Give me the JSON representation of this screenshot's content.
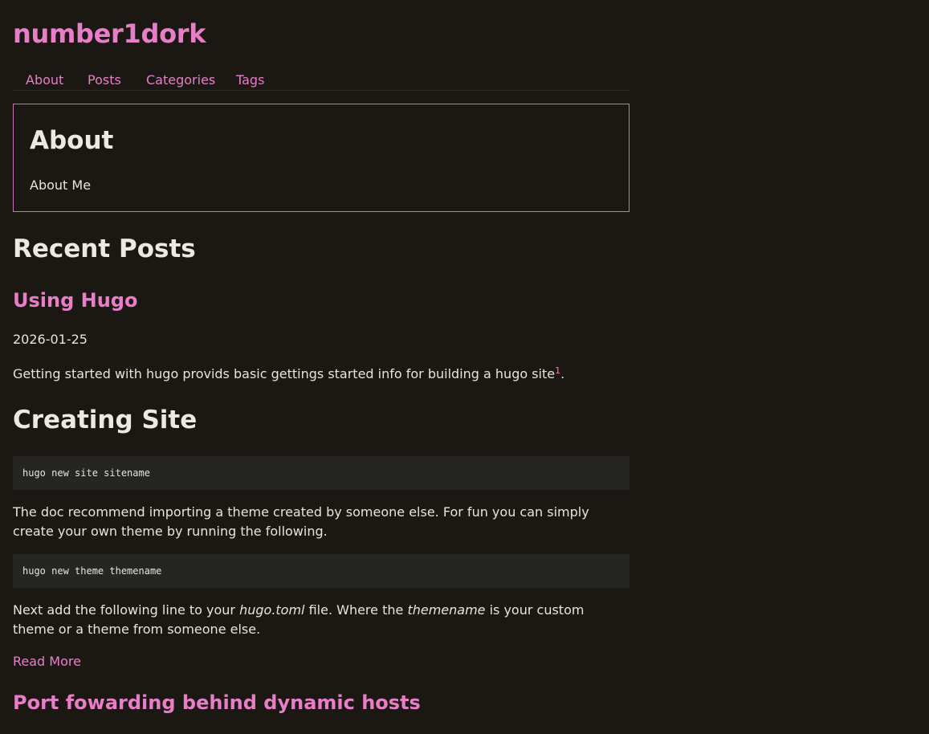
{
  "site": {
    "title": "number1dork"
  },
  "nav": {
    "items": [
      {
        "label": "About"
      },
      {
        "label": "Posts"
      },
      {
        "label": "Categories"
      },
      {
        "label": "Tags"
      }
    ]
  },
  "about": {
    "heading": "About",
    "link_label": "About Me"
  },
  "recent": {
    "heading": "Recent Posts",
    "posts": [
      {
        "title": "Using Hugo",
        "date": "2026-01-25",
        "intro": "Getting started with hugo provids basic gettings started info for building a hugo site",
        "footnote": "1",
        "intro_end": ".",
        "section_heading": "Creating Site",
        "code1": "hugo new site sitename",
        "para1": "The doc recommend importing a theme created by someone else. For fun you can simply create your own theme by running the following.",
        "code2": "hugo new theme themename",
        "para2_a": "Next add the following line to your ",
        "para2_em1": "hugo.toml",
        "para2_b": " file. Where the ",
        "para2_em2": "themename",
        "para2_c": " is your custom theme or a theme from someone else.",
        "read_more": "Read More"
      },
      {
        "title": "Port fowarding behind dynamic hosts"
      }
    ]
  },
  "colors": {
    "background": "#1b1813",
    "accent": "#e87ec8",
    "text": "#e8e4dc",
    "code_bg": "#252623"
  }
}
